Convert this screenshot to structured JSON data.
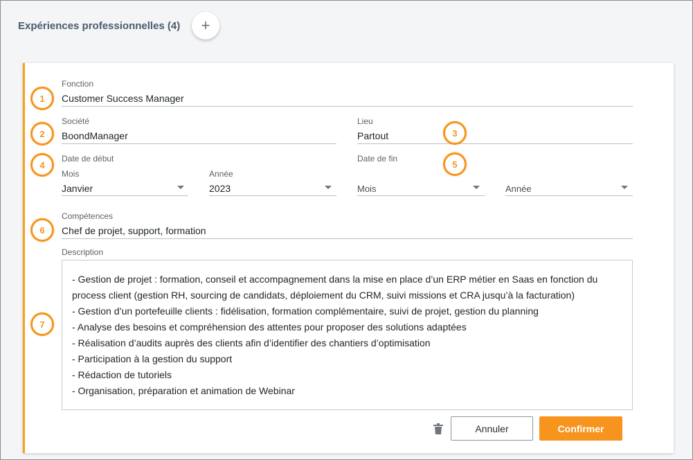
{
  "section": {
    "title": "Expériences professionnelles (4)",
    "add_icon": "plus-icon"
  },
  "badges": [
    "1",
    "2",
    "3",
    "4",
    "5",
    "6",
    "7"
  ],
  "form": {
    "function": {
      "label": "Fonction",
      "value": "Customer Success Manager"
    },
    "company": {
      "label": "Société",
      "value": "BoondManager"
    },
    "location": {
      "label": "Lieu",
      "value": "Partout"
    },
    "start_date": {
      "label": "Date de début",
      "month_label": "Mois",
      "month_value": "Janvier",
      "year_label": "Année",
      "year_value": "2023"
    },
    "end_date": {
      "label": "Date de fin",
      "month_placeholder": "Mois",
      "year_placeholder": "Année"
    },
    "skills": {
      "label": "Compétences",
      "value": "Chef de projet, support, formation"
    },
    "description": {
      "label": "Description",
      "lines": [
        "- Gestion de projet : formation, conseil et accompagnement dans la mise en place d’un ERP métier en Saas en fonction du",
        "process client (gestion RH, sourcing de candidats, déploiement du CRM, suivi missions et CRA jusqu’à la facturation)",
        "- Gestion d’un portefeuille clients : fidélisation, formation complémentaire, suivi de projet, gestion du planning",
        "- Analyse des besoins et compréhension des attentes pour proposer des solutions adaptées",
        "- Réalisation d’audits auprès des clients afin d’identifier des chantiers d’optimisation",
        "- Participation à la gestion du support",
        "- Rédaction de tutoriels",
        "- Organisation, préparation et animation de Webinar"
      ]
    }
  },
  "actions": {
    "delete_icon": "trash-icon",
    "cancel_label": "Annuler",
    "confirm_label": "Confirmer"
  },
  "colors": {
    "accent": "#f7941d",
    "card_border": "#f7a11a",
    "title": "#4a5a6c"
  }
}
